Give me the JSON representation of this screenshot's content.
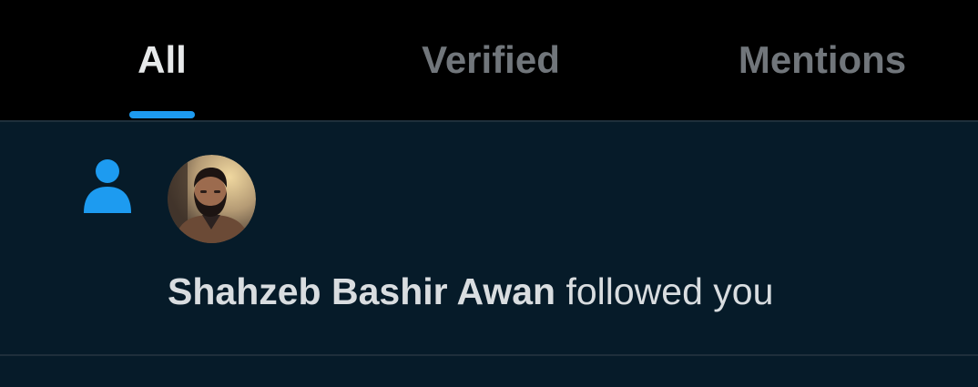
{
  "tabs": [
    {
      "label": "All",
      "selected": true
    },
    {
      "label": "Verified",
      "selected": false
    },
    {
      "label": "Mentions",
      "selected": false
    }
  ],
  "notification": {
    "icon": "person-icon",
    "avatar": "user-avatar",
    "user_name": "Shahzeb Bashir Awan",
    "action_text": "followed you"
  },
  "colors": {
    "accent": "#1d9bf0",
    "background": "#061b29",
    "tabbar_background": "#000000",
    "active_tab_text": "#e7e9ea",
    "inactive_tab_text": "#71767b"
  }
}
